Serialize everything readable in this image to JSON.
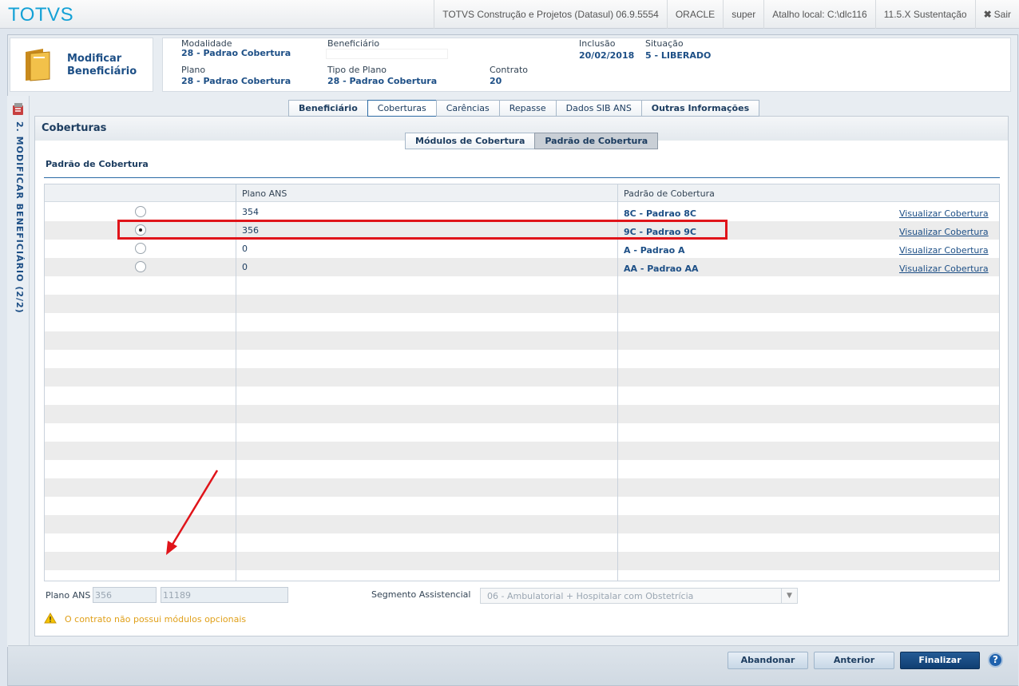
{
  "topbar": {
    "brand": "TOTVS",
    "product": "TOTVS Construção e Projetos (Datasul) 06.9.5554",
    "database": "ORACLE",
    "user": "super",
    "shortcut": "Atalho local: C:\\dlc116",
    "version": "11.5.X Sustentação",
    "exit_label": "Sair"
  },
  "side": {
    "step_label": "2. MODIFICAR BENEFICIÁRIO (2/2)"
  },
  "header": {
    "title": "Modificar Beneficiário",
    "modalidade_label": "Modalidade",
    "modalidade_value": "28 - Padrao Cobertura",
    "beneficiario_label": "Beneficiário",
    "inclusao_label": "Inclusão",
    "inclusao_value": "20/02/2018",
    "situacao_label": "Situação",
    "situacao_value": "5 - LIBERADO",
    "plano_label": "Plano",
    "plano_value": "28 - Padrao Cobertura",
    "tipo_plano_label": "Tipo de Plano",
    "tipo_plano_value": "28 - Padrao Cobertura",
    "contrato_label": "Contrato",
    "contrato_value": "20"
  },
  "tabs": [
    {
      "label": "Beneficiário"
    },
    {
      "label": "Coberturas"
    },
    {
      "label": "Carências"
    },
    {
      "label": "Repasse"
    },
    {
      "label": "Dados SIB ANS"
    },
    {
      "label": "Outras Informações"
    }
  ],
  "panel": {
    "title": "Coberturas",
    "subtabs": [
      {
        "label": "Módulos de Cobertura"
      },
      {
        "label": "Padrão de Cobertura"
      }
    ],
    "section_title": "Padrão de Cobertura"
  },
  "grid": {
    "columns": [
      "Plano ANS",
      "Padrão de Cobertura"
    ],
    "rows": [
      {
        "plano": "354",
        "padrao": "8C - Padrao 8C",
        "link": "Visualizar Cobertura",
        "selected": false
      },
      {
        "plano": "356",
        "padrao": "9C - Padrao 9C",
        "link": "Visualizar Cobertura",
        "selected": true
      },
      {
        "plano": "0",
        "padrao": "A - Padrao A",
        "link": "Visualizar Cobertura",
        "selected": false
      },
      {
        "plano": "0",
        "padrao": "AA - Padrao AA",
        "link": "Visualizar Cobertura",
        "selected": false
      }
    ]
  },
  "footer": {
    "plano_ans_label": "Plano ANS",
    "plano_ans_code": "356",
    "plano_ans_number": "11189",
    "segmento_label": "Segmento Assistencial",
    "segmento_value": "06 - Ambulatorial + Hospitalar com Obstetrícia",
    "warning": "O contrato não possui módulos opcionais"
  },
  "buttons": {
    "abandonar": "Abandonar",
    "anterior": "Anterior",
    "finalizar": "Finalizar",
    "help": "?"
  },
  "colors": {
    "brand": "#14a1d6",
    "highlight": "#e0141a",
    "primary": "#0f3e72",
    "warning": "#e0a01a"
  }
}
